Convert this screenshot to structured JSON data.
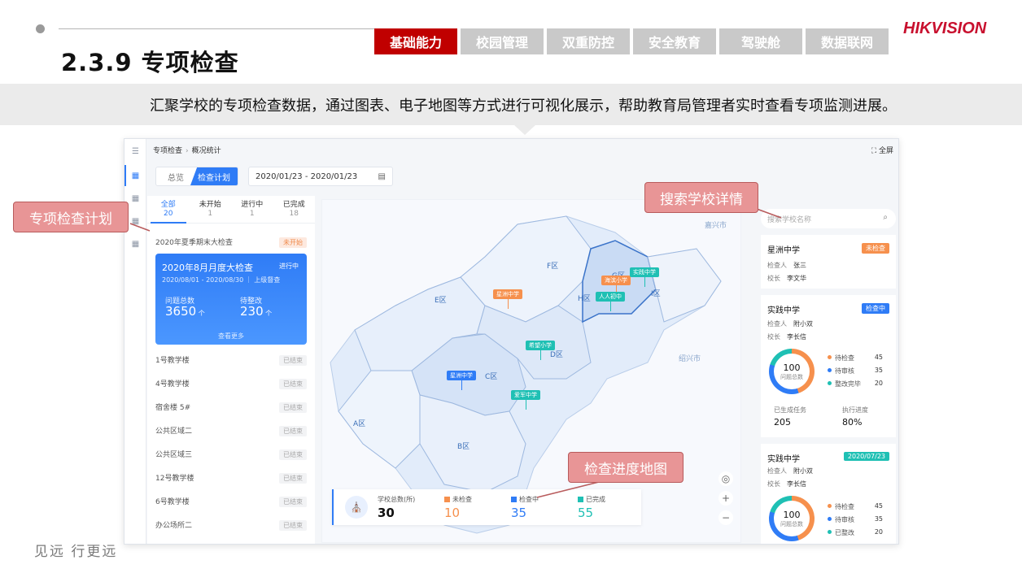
{
  "slide": {
    "title": "2.3.9 专项检查",
    "subtitle": "汇聚学校的专项检查数据，通过图表、电子地图等方式进行可视化展示，帮助教育局管理者实时查看专项监测进展。",
    "slogan": "见远 行更远",
    "logo": "HIKVISION",
    "tabs": [
      "基础能力",
      "校园管理",
      "双重防控",
      "安全教育",
      "驾驶舱",
      "数据联网"
    ],
    "callouts": {
      "plan": "专项检查计划",
      "search": "搜索学校详情",
      "map": "检查进度地图"
    }
  },
  "app": {
    "breadcrumb": [
      "专项检查",
      "概况统计"
    ],
    "fullscreen": "全屏",
    "segment": [
      "总览",
      "检查计划"
    ],
    "date_range": "2020/01/23 - 2020/01/23",
    "filter_tabs": [
      {
        "label": "全部",
        "count": "20"
      },
      {
        "label": "未开始",
        "count": "1"
      },
      {
        "label": "进行中",
        "count": "1"
      },
      {
        "label": "已完成",
        "count": "18"
      }
    ],
    "plan_top": {
      "name": "2020年夏季期末大检查",
      "status": "未开始"
    },
    "plan_card": {
      "name": "2020年8月月度大检查",
      "status": "进行中",
      "date": "2020/08/01 - 2020/08/30",
      "level": "上级督查",
      "issues_label": "问题总数",
      "issues_value": "3650",
      "pending_label": "待整改",
      "pending_value": "230",
      "more": "查看更多"
    },
    "plan_items": [
      {
        "name": "1号教学楼",
        "status": "已结束"
      },
      {
        "name": "4号教学楼",
        "status": "已结束"
      },
      {
        "name": "宿舍楼 5#",
        "status": "已结束"
      },
      {
        "name": "公共区域二",
        "status": "已结束"
      },
      {
        "name": "公共区域三",
        "status": "已结束"
      },
      {
        "name": "12号教学楼",
        "status": "已结束"
      },
      {
        "name": "6号教学楼",
        "status": "已结束"
      },
      {
        "name": "办公场所二",
        "status": "已结束"
      }
    ],
    "map": {
      "regions": [
        "A区",
        "B区",
        "C区",
        "D区",
        "E区",
        "F区",
        "H区",
        "I区",
        "G区"
      ],
      "cities": [
        "嘉兴市",
        "绍兴市"
      ],
      "pins": [
        {
          "label": "星洲中学",
          "color": "#f6904d"
        },
        {
          "label": "海滨小学",
          "color": "#f6904d"
        },
        {
          "label": "实践中学",
          "color": "#1fc0b4"
        },
        {
          "label": "人人初中",
          "color": "#1fc0b4"
        },
        {
          "label": "希望小学",
          "color": "#1fc0b4"
        },
        {
          "label": "星洲中学",
          "color": "#2f7cf6"
        },
        {
          "label": "爱军中学",
          "color": "#1fc0b4"
        }
      ],
      "stats": {
        "total_label": "学校总数(所)",
        "total": "30",
        "unchecked_label": "未检查",
        "unchecked": "10",
        "checking_label": "检查中",
        "checking": "35",
        "done_label": "已完成",
        "done": "55"
      }
    },
    "search_placeholder": "搜索学校名称",
    "school_cards": [
      {
        "name": "星洲中学",
        "badge": "未检查",
        "badge_color": "#f6904d",
        "inspector_label": "检查人",
        "inspector": "张三",
        "principal_label": "校长",
        "principal": "李文华"
      },
      {
        "name": "实践中学",
        "badge": "检查中",
        "badge_color": "#2f7cf6",
        "inspector_label": "检查人",
        "inspector": "附小双",
        "principal_label": "校长",
        "principal": "李长信",
        "donut_value": "100",
        "donut_label": "问题总数",
        "legend": [
          {
            "label": "待检查",
            "value": "45",
            "color": "#f6904d"
          },
          {
            "label": "待审核",
            "value": "35",
            "color": "#2f7cf6"
          },
          {
            "label": "整改完毕",
            "value": "20",
            "color": "#1fc0b4"
          }
        ],
        "tasks_label": "已生成任务",
        "tasks": "205",
        "progress_label": "执行进度",
        "progress": "80%"
      },
      {
        "name": "实践中学",
        "badge": "2020/07/23",
        "badge_color": "#1fc0b4",
        "inspector_label": "检查人",
        "inspector": "附小双",
        "principal_label": "校长",
        "principal": "李长信",
        "donut_value": "100",
        "donut_label": "问题总数",
        "legend": [
          {
            "label": "待检查",
            "value": "45",
            "color": "#f6904d"
          },
          {
            "label": "待审核",
            "value": "35",
            "color": "#2f7cf6"
          },
          {
            "label": "已整改",
            "value": "20",
            "color": "#1fc0b4"
          }
        ]
      }
    ]
  }
}
